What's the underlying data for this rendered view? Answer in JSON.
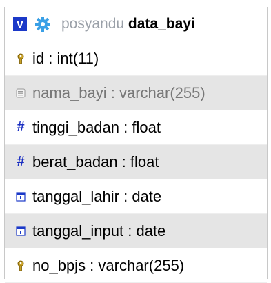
{
  "header": {
    "db": "posyandu",
    "table": "data_bayi"
  },
  "columns": [
    {
      "label": "id : int(11)",
      "icon": "key-icon"
    },
    {
      "label": "nama_bayi : varchar(255)",
      "icon": "text-column-icon"
    },
    {
      "label": "tinggi_badan : float",
      "icon": "hash-icon"
    },
    {
      "label": "berat_badan : float",
      "icon": "hash-icon"
    },
    {
      "label": "tanggal_lahir : date",
      "icon": "date-icon"
    },
    {
      "label": "tanggal_input : date",
      "icon": "date-icon"
    },
    {
      "label": "no_bpjs : varchar(255)",
      "icon": "key-icon"
    }
  ]
}
